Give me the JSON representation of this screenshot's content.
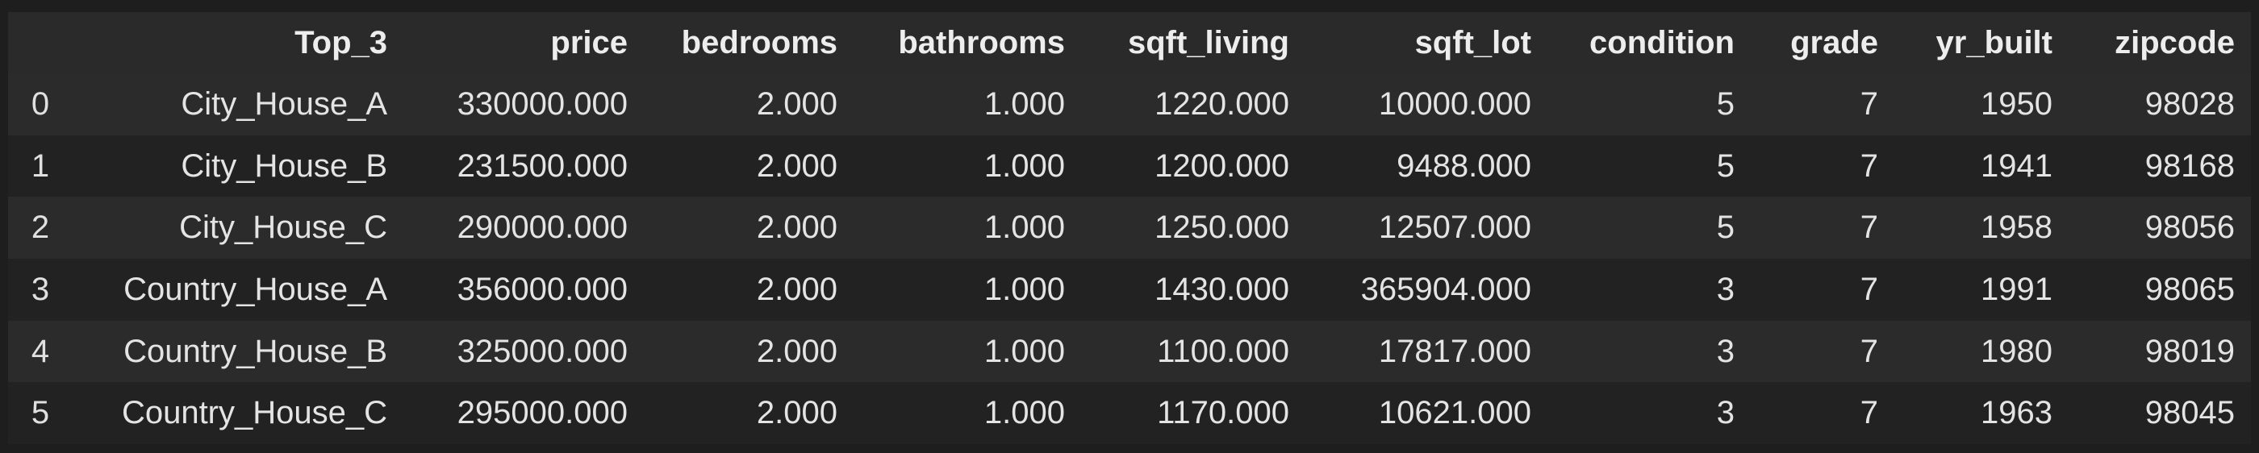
{
  "table": {
    "columns": [
      "",
      "Top_3",
      "price",
      "bedrooms",
      "bathrooms",
      "sqft_living",
      "sqft_lot",
      "condition",
      "grade",
      "yr_built",
      "zipcode"
    ],
    "rows": [
      [
        "0",
        "City_House_A",
        "330000.000",
        "2.000",
        "1.000",
        "1220.000",
        "10000.000",
        "5",
        "7",
        "1950",
        "98028"
      ],
      [
        "1",
        "City_House_B",
        "231500.000",
        "2.000",
        "1.000",
        "1200.000",
        "9488.000",
        "5",
        "7",
        "1941",
        "98168"
      ],
      [
        "2",
        "City_House_C",
        "290000.000",
        "2.000",
        "1.000",
        "1250.000",
        "12507.000",
        "5",
        "7",
        "1958",
        "98056"
      ],
      [
        "3",
        "Country_House_A",
        "356000.000",
        "2.000",
        "1.000",
        "1430.000",
        "365904.000",
        "3",
        "7",
        "1991",
        "98065"
      ],
      [
        "4",
        "Country_House_B",
        "325000.000",
        "2.000",
        "1.000",
        "1100.000",
        "17817.000",
        "3",
        "7",
        "1980",
        "98019"
      ],
      [
        "5",
        "Country_House_C",
        "295000.000",
        "2.000",
        "1.000",
        "1170.000",
        "10621.000",
        "3",
        "7",
        "1963",
        "98045"
      ]
    ]
  },
  "colors": {
    "background": "#1e1e1e",
    "header_bg": "#2a2a2a",
    "row_odd": "#2b2b2b",
    "row_even": "#222222",
    "text": "#e6e6e6"
  }
}
